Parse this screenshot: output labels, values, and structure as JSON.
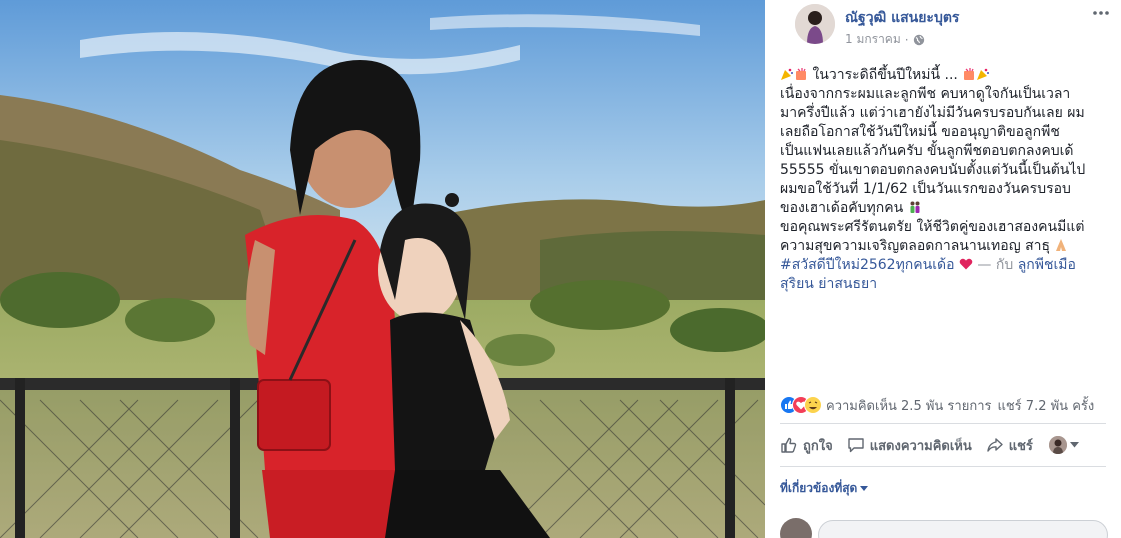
{
  "post": {
    "author_name": "ณัฐวุฒิ แสนยะบุตร",
    "date": "1 มกราคม",
    "privacy_icon": "globe-icon",
    "more_icon": "ellipsis-icon",
    "body_lines": [
      "ในวาระดิถีขึ้นปีใหม่นี้ ...",
      "เนื่องจากกระผมและลูกพีช คบหาดูใจกันเป็นเวลา",
      "มาครึ่งปีแล้ว แต่ว่าเฮายังไม่มีวันครบรอบกันเลย ผม",
      "เลยถือโอกาสใช้วันปีใหม่นี้ ขออนุญาติขอลูกพีช",
      "เป็นแฟนเลยแล้วกันครับ ขั้นลูกพีชตอบตกลงคบเด้",
      "55555 ขั่นเขาตอบตกลงคบนับตั้งแต่วันนี้เป็นต้นไป",
      "ผมขอใช้วันที่ 1/1/62 เป็นวันแรกของวันครบรอบ",
      "ของเฮาเด้อคับทุกคน",
      "ขอคุณพระศรีรัตนตรัย ให้ชีวิตคู่ของเฮาสองคนมีแต่",
      "ความสุขความเจริญตลอดกาลนานเทอญ สาธุ"
    ],
    "hashtag": "#สวัสดีปีใหม่2562ทุกคนเด้อ",
    "with_text": "— กับ",
    "tagged_line1": "ลูกพีชเมือ",
    "tagged_line2": "สุริยน ย่าสนธยา"
  },
  "stats": {
    "comments_label": "ความคิดเห็น 2.5 พัน รายการ",
    "shares_label": "แชร์ 7.2 พัน ครั้ง"
  },
  "actions": {
    "like_label": "ถูกใจ",
    "comment_label": "แสดงความคิดเห็น",
    "share_label": "แชร์"
  },
  "relevant_label": "ที่เกี่ยวข้องที่สุด",
  "colors": {
    "link": "#365899",
    "muted": "#90949c",
    "like_blue": "#1877f2",
    "love_red": "#f33e58"
  }
}
